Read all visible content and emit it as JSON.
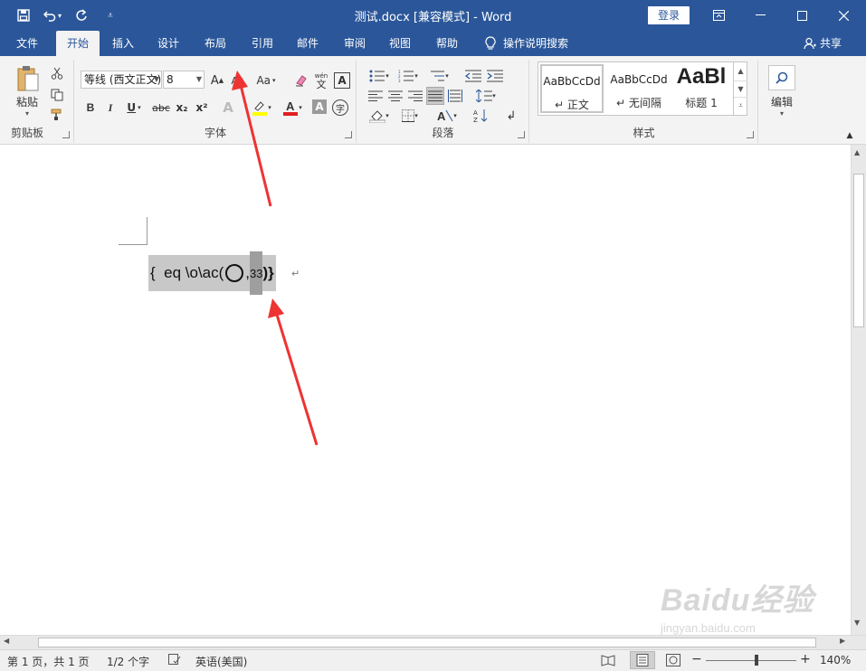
{
  "titlebar": {
    "title": "测试.docx [兼容模式] - Word",
    "login_label": "登录",
    "bg_color": "#2b579a"
  },
  "tabs": [
    {
      "label": "文件"
    },
    {
      "label": "开始"
    },
    {
      "label": "插入"
    },
    {
      "label": "设计"
    },
    {
      "label": "布局"
    },
    {
      "label": "引用"
    },
    {
      "label": "邮件"
    },
    {
      "label": "审阅"
    },
    {
      "label": "视图"
    },
    {
      "label": "帮助"
    }
  ],
  "tellme": {
    "label": "操作说明搜索"
  },
  "share": {
    "label": "共享"
  },
  "ribbon": {
    "clipboard": {
      "paste_label": "粘贴",
      "group_label": "剪贴板"
    },
    "font": {
      "font_name": "等线 (西文正文)",
      "font_size": "8",
      "grow_font": "A",
      "shrink_font": "A",
      "change_case": "Aa",
      "bold": "B",
      "italic": "I",
      "underline": "U",
      "strikethrough": "abc",
      "subscript": "x₂",
      "superscript": "x²",
      "group_label": "字体"
    },
    "paragraph": {
      "group_label": "段落"
    },
    "styles": {
      "items": [
        {
          "sample": "AaBbCcDd",
          "name": "正文"
        },
        {
          "sample": "AaBbCcDd",
          "name": "无间隔"
        },
        {
          "sample": "AaBl",
          "name": "标题 1"
        }
      ],
      "group_label": "样式"
    },
    "editing": {
      "label": "编辑"
    }
  },
  "document": {
    "field_prefix": "{  eq \\o\\ac(",
    "field_sep": ",",
    "field_selected": "33",
    "field_suffix": ")}",
    "para_mark": "↵"
  },
  "statusbar": {
    "page": "第 1 页，共 1 页",
    "words": "1/2 个字",
    "language": "英语(美国)",
    "zoom": "140%"
  },
  "watermark": {
    "brand": "Baidu经验",
    "url": "jingyan.baidu.com"
  }
}
